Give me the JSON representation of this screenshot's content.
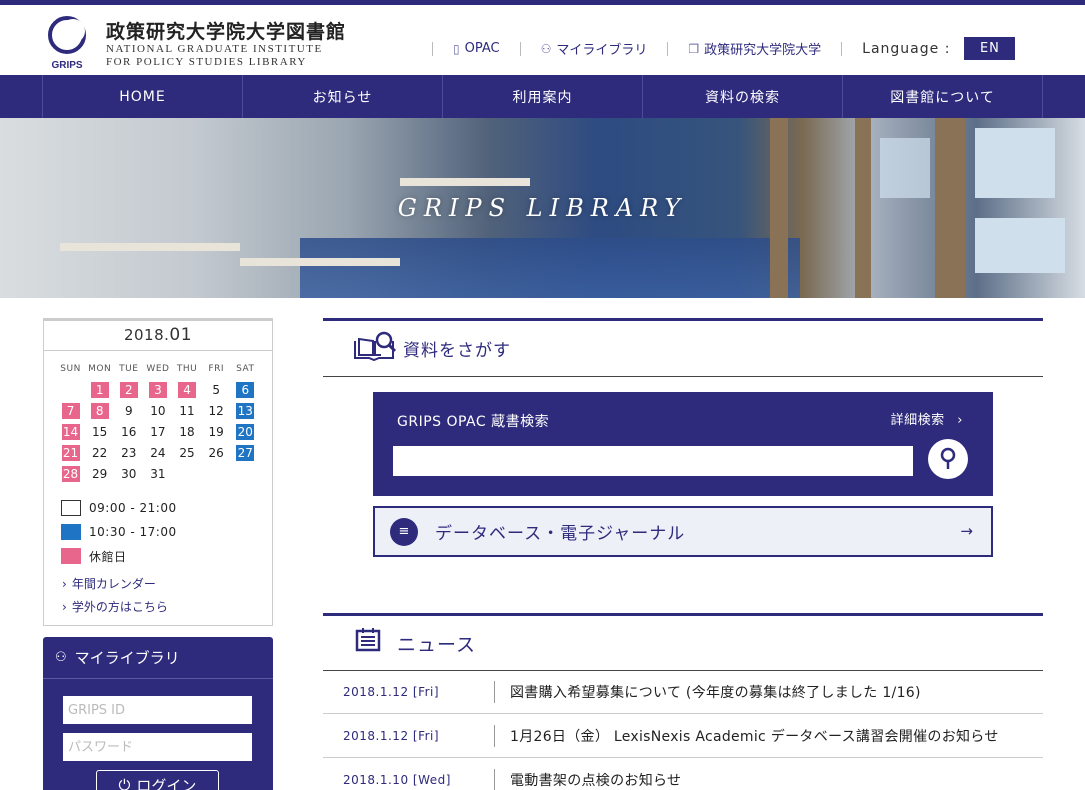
{
  "header": {
    "logo_jp": "政策研究大学院大学図書館",
    "logo_en_line1": "NATIONAL GRADUATE INSTITUTE",
    "logo_en_line2": "FOR POLICY STUDIES LIBRARY",
    "logo_mark_text": "GRIPS",
    "links": [
      {
        "label": "OPAC",
        "icon": "book-icon"
      },
      {
        "label": "マイライブラリ",
        "icon": "users-icon"
      },
      {
        "label": "政策研究大学院大学",
        "icon": "copy-icon"
      }
    ],
    "language_label": "Language :",
    "language_button": "EN"
  },
  "nav": [
    "HOME",
    "お知らせ",
    "利用案内",
    "資料の検索",
    "図書館について"
  ],
  "hero": {
    "title": "GRIPS LIBRARY"
  },
  "calendar": {
    "year_prefix": "2018.",
    "month": "01",
    "dows": [
      "SUN",
      "MON",
      "TUE",
      "WED",
      "THU",
      "FRI",
      "SAT"
    ],
    "weeks": [
      [
        {
          "d": ""
        },
        {
          "d": "1",
          "t": "closed"
        },
        {
          "d": "2",
          "t": "closed"
        },
        {
          "d": "3",
          "t": "closed"
        },
        {
          "d": "4",
          "t": "closed"
        },
        {
          "d": "5"
        },
        {
          "d": "6",
          "t": "short"
        }
      ],
      [
        {
          "d": "7",
          "t": "closed"
        },
        {
          "d": "8",
          "t": "closed"
        },
        {
          "d": "9"
        },
        {
          "d": "10"
        },
        {
          "d": "11"
        },
        {
          "d": "12"
        },
        {
          "d": "13",
          "t": "short"
        }
      ],
      [
        {
          "d": "14",
          "t": "closed"
        },
        {
          "d": "15"
        },
        {
          "d": "16"
        },
        {
          "d": "17"
        },
        {
          "d": "18"
        },
        {
          "d": "19"
        },
        {
          "d": "20",
          "t": "short"
        }
      ],
      [
        {
          "d": "21",
          "t": "closed"
        },
        {
          "d": "22"
        },
        {
          "d": "23"
        },
        {
          "d": "24"
        },
        {
          "d": "25"
        },
        {
          "d": "26"
        },
        {
          "d": "27",
          "t": "short"
        }
      ],
      [
        {
          "d": "28",
          "t": "closed"
        },
        {
          "d": "29"
        },
        {
          "d": "30"
        },
        {
          "d": "31"
        },
        {
          "d": ""
        },
        {
          "d": ""
        },
        {
          "d": ""
        }
      ]
    ],
    "legend": {
      "open": "09:00 - 21:00",
      "short": "10:30 - 17:00",
      "closed": "休館日"
    },
    "links": [
      "年間カレンダー",
      "学外の方はこちら"
    ],
    "colors": {
      "closed": "#e8668c",
      "short": "#1f74c3"
    }
  },
  "mylibrary": {
    "title": "マイライブラリ",
    "id_placeholder": "GRIPS ID",
    "password_placeholder": "パスワード",
    "login_label": "ログイン"
  },
  "search": {
    "section_title": "資料をさがす",
    "opac_title": "GRIPS OPAC 蔵書検索",
    "advanced_link": "詳細検索",
    "database_label": "データベース・電子ジャーナル"
  },
  "news": {
    "section_title": "ニュース",
    "items": [
      {
        "date": "2018.1.12 [Fri]",
        "text": "図書購入希望募集について (今年度の募集は終了しました 1/16)"
      },
      {
        "date": "2018.1.12 [Fri]",
        "text": "1月26日（金） LexisNexis Academic データベース講習会開催のお知らせ"
      },
      {
        "date": "2018.1.10 [Wed]",
        "text": "電動書架の点検のお知らせ"
      }
    ]
  },
  "theme": {
    "primary": "#2e2a7c"
  }
}
